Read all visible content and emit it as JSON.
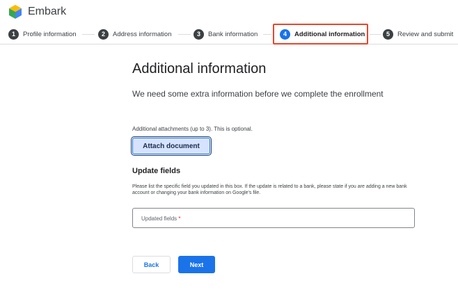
{
  "app": {
    "name": "Embark"
  },
  "stepper": {
    "steps": [
      {
        "number": "1",
        "label": "Profile information"
      },
      {
        "number": "2",
        "label": "Address information"
      },
      {
        "number": "3",
        "label": "Bank information"
      },
      {
        "number": "4",
        "label": "Additional information",
        "active": true
      },
      {
        "number": "5",
        "label": "Review and submit"
      }
    ]
  },
  "page": {
    "title": "Additional information",
    "subtitle": "We need some extra information before we complete the enrollment",
    "attachments_label": "Additional attachments (up to 3). This is optional.",
    "attach_button": "Attach document",
    "update_title": "Update fields",
    "update_help": "Please list the specific field you updated in this box. If the update is related to a bank, please state if you are adding a new bank account or changing your bank information on Google's file.",
    "field_placeholder": "Updated fields",
    "field_required_mark": "*",
    "field_value": ""
  },
  "actions": {
    "back": "Back",
    "next": "Next"
  },
  "colors": {
    "accent": "#1a73e8",
    "highlight": "#e8452c",
    "step_default": "#3c4043"
  }
}
